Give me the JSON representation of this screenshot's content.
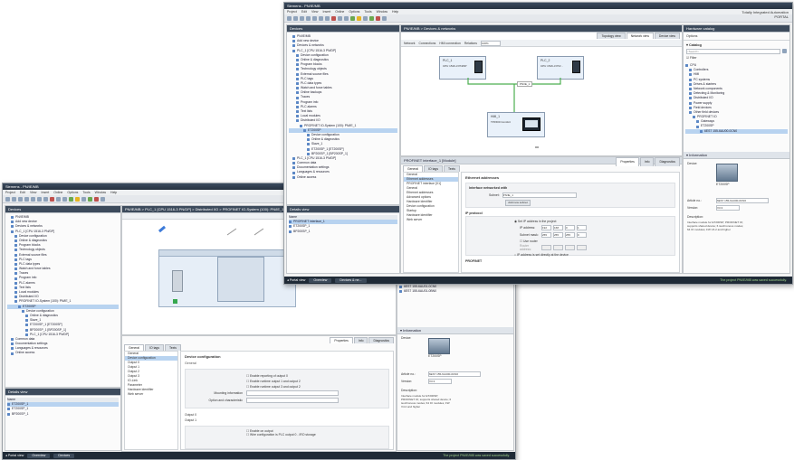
{
  "back": {
    "title": "Siemens - PN/IE/MB",
    "menu": [
      "Project",
      "Edit",
      "View",
      "Insert",
      "Online",
      "Options",
      "Tools",
      "Window",
      "Help"
    ],
    "devices_header": "Devices",
    "tree": [
      "PN/IE/MB",
      "Add new device",
      "Devices & networks",
      "PLC_1 [CPU 1516-3 PN/DP]",
      "Device configuration",
      "Online & diagnostics",
      "Program blocks",
      "Technology objects",
      "External source files",
      "PLC tags",
      "PLC data types",
      "Watch and force tables",
      "Traces",
      "Program info",
      "PLC alarms",
      "Text lists",
      "Local modules",
      "Distributed I/O",
      "PROFINET IO-System (100): PN/IE_1",
      "ET200SP",
      "Device configuration",
      "Online & diagnostics",
      "Slave_1",
      "ET200SP_1 [ET200SP]",
      "BP200SP_1 [BP200SP_1]",
      "PLC_1 [CPU 1516-3 PN/DP]",
      "Common data",
      "Documentation settings",
      "Languages & resources",
      "Online access"
    ],
    "details_header": "Details view",
    "details_col": "Name",
    "details_rows": [
      "ET200SP_1",
      "ET200SP_1",
      "BP200SP_1"
    ],
    "editor_title": "PN/IE/MB > PLC_1 [CPU 1516-3 PN/DP] > Distributed I/O > PROFINET IO-System (100): PN/IE_1 > ET200SP",
    "props_tabs": [
      "General",
      "IO tags",
      "Texts"
    ],
    "props_right_tabs": [
      "Properties",
      "Info",
      "Diagnostics"
    ],
    "nav": [
      "General",
      "Device configuration",
      "Output 0",
      "Output 1",
      "Output 2",
      "Output 3",
      "IO-Link",
      "Parameter",
      "Hardware identifier",
      "Web server"
    ],
    "section_title": "Device configuration",
    "section_sub": "General",
    "options": [
      "Enable reporting of output 0",
      "Enable runtime output 1 and output 2",
      "Enable runtime output 3 and output 2"
    ],
    "field1_label": "Mounting information",
    "field2_label": "Option and characteristic",
    "field1_value": "",
    "field2_value": "",
    "section2": "Output 0",
    "section3": "Output 1",
    "checkbox2a": "Enable on output",
    "checkbox2b": "Wire configuration is PLC output 0 - IRO storage",
    "status_portal": "Portal view",
    "status_tabs": [
      "Overview",
      "Devices"
    ],
    "status_msg": "The project PN/IE/MB was saved successfully."
  },
  "front": {
    "title": "Siemens - PN/IE/MB",
    "menu": [
      "Project",
      "Edit",
      "View",
      "Insert",
      "Online",
      "Options",
      "Tools",
      "Window",
      "Help"
    ],
    "brand_line1": "Totally Integrated Automation",
    "brand_line2": "PORTAL",
    "devices_header": "Devices",
    "tree": [
      "PN/IE/MB",
      "Add new device",
      "Devices & networks",
      "PLC_1 [CPU 1516-3 PN/DP]",
      "Device configuration",
      "Online & diagnostics",
      "Program blocks",
      "Technology objects",
      "External source files",
      "PLC tags",
      "PLC data types",
      "Watch and force tables",
      "Online backups",
      "Traces",
      "Program info",
      "PLC alarms",
      "Text lists",
      "Local modules",
      "Distributed I/O",
      "PROFINET IO-System (100): PN/IE_1",
      "ET200SP",
      "Device configuration",
      "Online & diagnostics",
      "Slave_1",
      "ET200SP_1 [ET200SP]",
      "BP200SP_1 [BP200SP_1]",
      "PLC_1 [CPU 1516-3 PN/DP]",
      "Common data",
      "Documentation settings",
      "Languages & resources",
      "Online access"
    ],
    "details_header": "Details view",
    "details_col": "Name",
    "details_rows": [
      "PROFINET interface_1",
      "ET200SP_1",
      "BP200SP_1"
    ],
    "editor_title": "PN/IE/MB > Devices & networks",
    "view_tabs": [
      "Topology view",
      "Network view",
      "Device view"
    ],
    "network_tb": [
      "Network",
      "Connections",
      "HMI connection",
      "Relations",
      "100%"
    ],
    "plc1_name": "PLC_1",
    "plc1_type": "CPU 1516-3 PN/DP",
    "plc2_name": "PLC_2",
    "plc2_type": "CPU 1516-3 PN/...",
    "hmi_name": "HMI_1",
    "hmi_type": "TP1500 Comfort",
    "net_label": "PN/IE_1",
    "props_title": "PROFINET interface_1 [Module]",
    "props_right_tabs": [
      "Properties",
      "Info",
      "Diagnostics"
    ],
    "props_tabs": [
      "General",
      "IO tags",
      "Texts"
    ],
    "nav": [
      "General",
      "Ethernet addresses",
      "PROFINET interface [X1]",
      "General",
      "Ethernet addresses",
      "Advanced options",
      "Hardware identifier",
      "Device configuration",
      "Startup",
      "Hardware identifier",
      "Web server"
    ],
    "eth_title": "Ethernet addresses",
    "eth_sub": "Interface networked with",
    "subnet_label": "Subnet:",
    "subnet_value": "PN/IE_1",
    "add_subnet": "Add new subnet",
    "ip_title": "IP protocol",
    "ip_opt1": "Set IP address in the project",
    "ip_label": "IP address:",
    "ip_value": [
      "192",
      "168",
      "0",
      "1"
    ],
    "mask_label": "Subnet mask:",
    "mask_value": [
      "255",
      "255",
      "255",
      "0"
    ],
    "router_label": "Use router",
    "router_addr": "Router address:",
    "ip_opt2": "IP address is set directly at the device",
    "profinet_title": "PROFINET",
    "catalog_header": "Hardware catalog",
    "options_header": "Options",
    "catalog_title": "Catalog",
    "catalog_search": "<Search>",
    "catalog_filter": "Filter",
    "catalog_items": [
      "CPU",
      "Controllers",
      "HMI",
      "PC systems",
      "Drives & starters",
      "Network components",
      "Detecting & Monitoring",
      "Distributed I/O",
      "Power supply",
      "Field devices",
      "Other field devices",
      "PROFINET IO",
      "Gateways",
      "ET200SP",
      "6ES7 155-6AU00-0CN0"
    ],
    "info_header": "Information",
    "info_device": "Device:",
    "info_name": "ET200SP",
    "info_article": "Article no.:",
    "info_article_val": "6ES7 155-6AU00-0CN0",
    "info_version": "Version:",
    "info_version_val": "V3.3",
    "info_desc_title": "Description:",
    "info_desc": "Interface module for ET200SP; PROFINET IO; supports shared device; 6 isochronous modes; 64 IO modules; FW V4.2 and higher",
    "status_portal": "Portal view",
    "status_tabs": [
      "Overview",
      "Devices & ne..."
    ],
    "status_msg": "The project PN/IE/MB was saved successfully."
  },
  "back_right": {
    "rows": [
      "6ES7 155-6AU00-0CN0",
      "6ES7 155-6AU01-0CN0",
      "6ES7 155-6AU01-0BN0"
    ],
    "info_header": "Information",
    "info_device": "Device:",
    "info_name": "ET200SP",
    "info_article": "Article no.:",
    "info_article_val": "6ES7 155-6AU00-0CN0",
    "info_version": "Version:",
    "info_version_val": "V3.3",
    "info_desc_title": "Description:",
    "info_desc": "Interface module for ET200SP; PROFINET IO; supports shared device; 6 isochronous modes; 64 IO modules; FW V4.2 and higher"
  },
  "colors": {
    "accent": "#2c6fb7",
    "network": "#4caf50",
    "titlebar": "#26313f"
  }
}
